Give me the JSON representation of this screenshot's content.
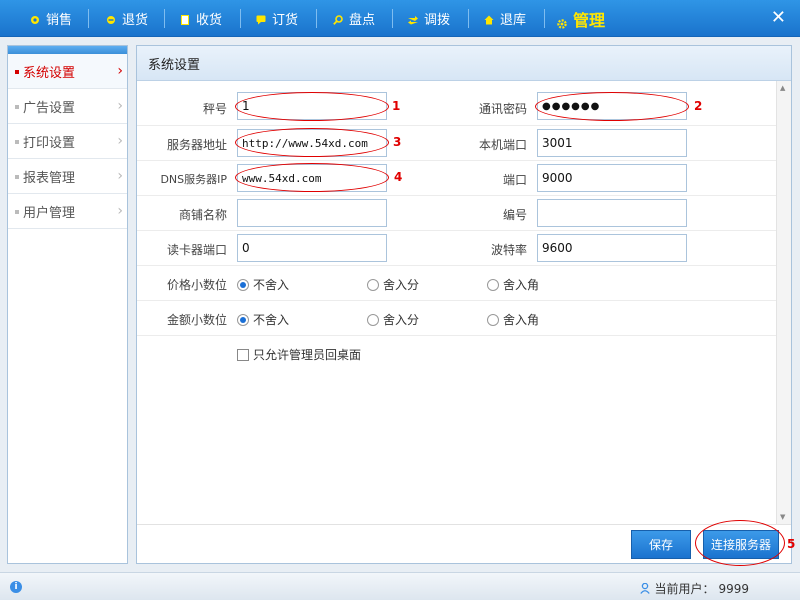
{
  "nav": {
    "items": [
      {
        "label": "销售",
        "icon": "circle-icon"
      },
      {
        "label": "退货",
        "icon": "circle-icon"
      },
      {
        "label": "收货",
        "icon": "document-icon"
      },
      {
        "label": "订货",
        "icon": "chat-icon"
      },
      {
        "label": "盘点",
        "icon": "search-icon"
      },
      {
        "label": "调拨",
        "icon": "swap-arrows-icon"
      },
      {
        "label": "退库",
        "icon": "house-icon"
      },
      {
        "label": "管理",
        "icon": "gear-icon",
        "active": true
      }
    ],
    "close_label": "✕"
  },
  "sidebar": {
    "items": [
      {
        "label": "系统设置",
        "active": true
      },
      {
        "label": "广告设置"
      },
      {
        "label": "打印设置"
      },
      {
        "label": "报表管理"
      },
      {
        "label": "用户管理"
      }
    ]
  },
  "panel": {
    "title": "系统设置"
  },
  "form": {
    "scale_no": {
      "label": "秤号",
      "value": "1"
    },
    "comm_password": {
      "label": "通讯密码",
      "value": "●●●●●●"
    },
    "server_address": {
      "label": "服务器地址",
      "value": "http://www.54xd.com"
    },
    "local_port": {
      "label": "本机端口",
      "value": "3001"
    },
    "dns_server_ip": {
      "label": "DNS服务器IP",
      "value": "www.54xd.com"
    },
    "port": {
      "label": "端口",
      "value": "9000"
    },
    "shop_name": {
      "label": "商铺名称",
      "value": ""
    },
    "code": {
      "label": "编号",
      "value": ""
    },
    "card_reader_port": {
      "label": "读卡器端口",
      "value": "0"
    },
    "baud_rate": {
      "label": "波特率",
      "value": "9600"
    },
    "price_decimal": {
      "label": "价格小数位",
      "options": [
        "不舍入",
        "舍入分",
        "舍入角"
      ],
      "selected": "不舍入"
    },
    "amount_decimal": {
      "label": "金额小数位",
      "options": [
        "不舍入",
        "舍入分",
        "舍入角"
      ],
      "selected": "不舍入"
    },
    "admin_only_desktop": {
      "label": "只允许管理员回桌面",
      "checked": false
    }
  },
  "buttons": {
    "save": "保存",
    "connect_server": "连接服务器"
  },
  "annotations": [
    "1",
    "2",
    "3",
    "4",
    "5"
  ],
  "status": {
    "current_user_label": "当前用户：",
    "current_user": "9999"
  },
  "colors": {
    "nav_bg": "#1f80db",
    "active_nav": "#ffe600",
    "active_side": "#d40000",
    "button": "#2a86de",
    "annotation": "#e00000"
  }
}
